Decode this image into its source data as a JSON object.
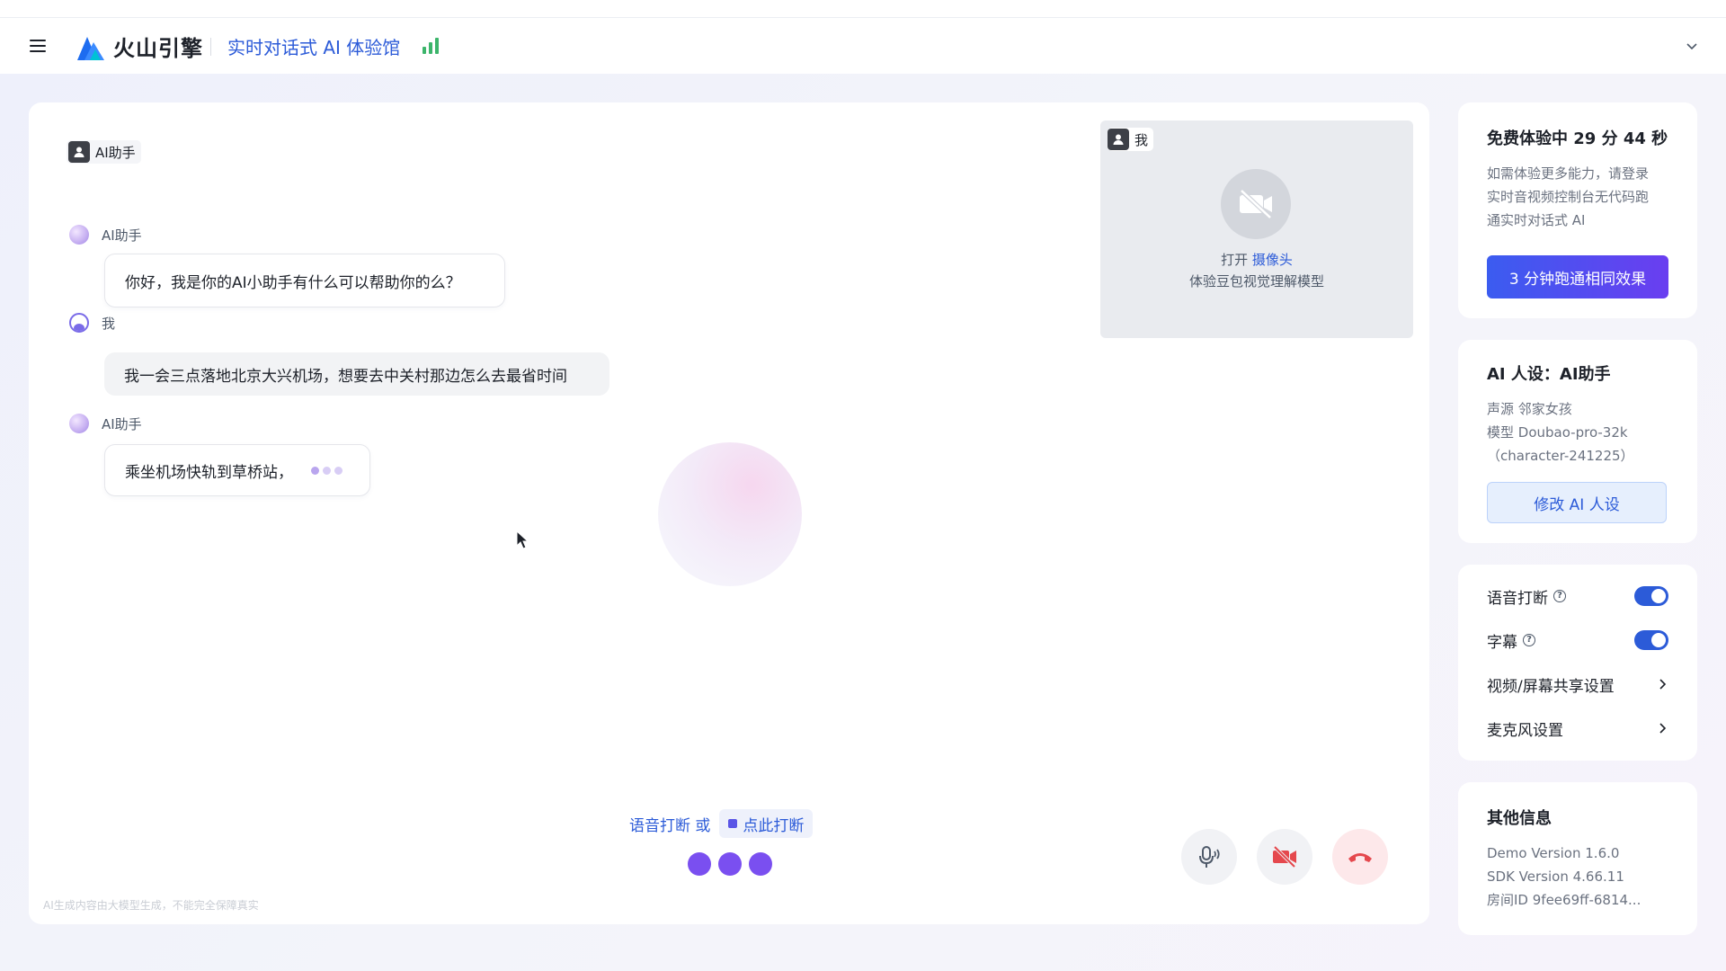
{
  "header": {
    "brand": "火山引擎",
    "title": "实时对话式 AI 体验馆",
    "icons": {
      "menu": "menu-icon",
      "signal": "signal-bars-icon",
      "expand": "chevron-down-icon"
    }
  },
  "colors": {
    "accent": "#2c5bd8",
    "signal": "#3cb56b",
    "hangup": "#e5484d",
    "voice_dot": "#7a4ff0"
  },
  "chat": {
    "ai_tag": "AI助手",
    "messages": [
      {
        "role": "ai",
        "name": "AI助手",
        "text": "你好，我是你的AI小助手有什么可以帮助你的么？"
      },
      {
        "role": "me",
        "name": "我",
        "text": "我一会三点落地北京大兴机场，想要去中关村那边怎么去最省时间"
      },
      {
        "role": "ai",
        "name": "AI助手",
        "text": "乘坐机场快轨到草桥站，"
      }
    ],
    "interrupt_text": "语音打断 或",
    "interrupt_button": "点此打断",
    "disclaimer": "AI生成内容由大模型生成，不能完全保障真实"
  },
  "camera": {
    "tag": "我",
    "open_prefix": "打开",
    "open_link": "摄像头",
    "hint": "体验豆包视觉理解模型"
  },
  "trial": {
    "title": "免费体验中 29 分 44 秒",
    "lines": [
      "如需体验更多能力，请登录",
      "实时音视频控制台无代码跑",
      "通实时对话式 AI"
    ],
    "button": "3 分钟跑通相同效果"
  },
  "persona": {
    "title": "AI 人设：AI助手",
    "lines": [
      "声源 邻家女孩",
      "模型 Doubao-pro-32k",
      "（character-241225）"
    ],
    "button": "修改 AI 人设"
  },
  "settings": {
    "voice_interrupt": {
      "label": "语音打断",
      "enabled": true
    },
    "subtitles": {
      "label": "字幕",
      "enabled": true
    },
    "video_share": "视频/屏幕共享设置",
    "mic": "麦克风设置"
  },
  "info": {
    "title": "其他信息",
    "lines": [
      "Demo Version 1.6.0",
      "SDK Version 4.66.11",
      "房间ID  9fee69ff-6814..."
    ]
  }
}
